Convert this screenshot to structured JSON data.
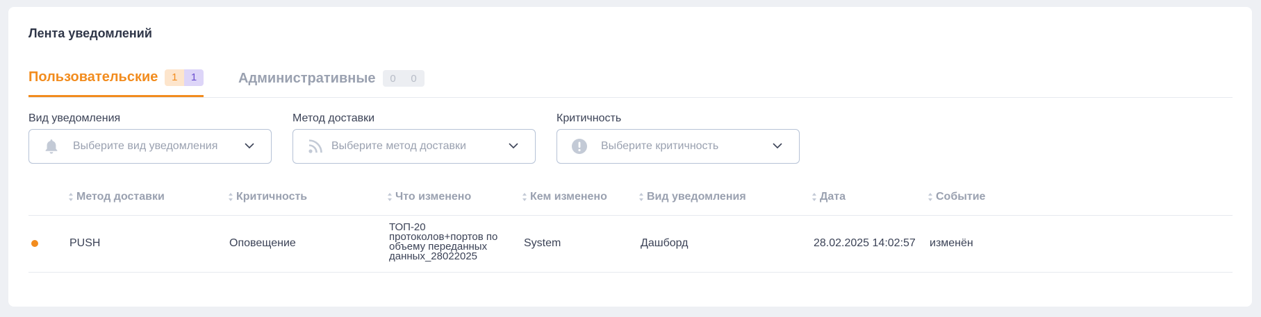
{
  "title": "Лента уведомлений",
  "tabs": [
    {
      "label": "Пользовательские",
      "badges": [
        "1",
        "1"
      ]
    },
    {
      "label": "Административные",
      "badges": [
        "0",
        "0"
      ]
    }
  ],
  "filters": [
    {
      "label": "Вид уведомления",
      "placeholder": "Выберите вид уведомления",
      "icon": "bell-icon"
    },
    {
      "label": "Метод доставки",
      "placeholder": "Выберите метод доставки",
      "icon": "rss-icon"
    },
    {
      "label": "Критичность",
      "placeholder": "Выберите критичность",
      "icon": "exclamation-circle-icon"
    }
  ],
  "table": {
    "columns": [
      "Метод доставки",
      "Критичность",
      "Что изменено",
      "Кем изменено",
      "Вид уведомления",
      "Дата",
      "Событие"
    ],
    "rows": [
      {
        "method": "PUSH",
        "criticality": "Оповещение",
        "changed_what": "ТОП-20 протоколов+портов по объему переданных данных_28022025",
        "changed_by": "System",
        "type": "Дашборд",
        "date": "28.02.2025 14:02:57",
        "event": "изменён"
      }
    ]
  },
  "colors": {
    "accent": "#f28c1e",
    "muted": "#9aa1b0",
    "border": "#b6c2d6"
  }
}
